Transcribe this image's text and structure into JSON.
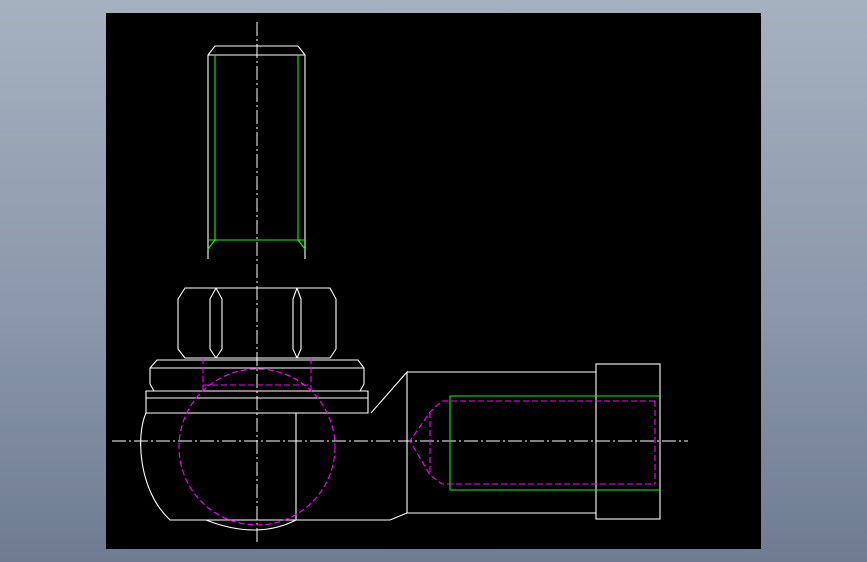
{
  "viewport": {
    "background": "#000000"
  },
  "drawing": {
    "type": "cad-2d-view",
    "subject": "angle-joint-ball-socket",
    "layers": {
      "outline": "#ffffff",
      "thread": "#00ff00",
      "hidden": "#ff00ff",
      "center": "#ffffff"
    },
    "linetypes": {
      "hidden": "dashed",
      "center": "dash-dot"
    }
  }
}
